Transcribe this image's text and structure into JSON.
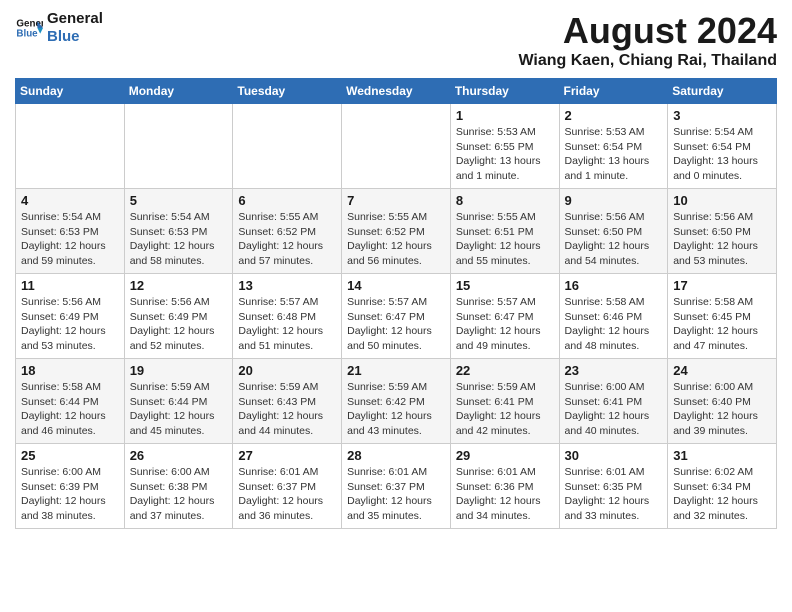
{
  "logo": {
    "text_general": "General",
    "text_blue": "Blue"
  },
  "title": {
    "month": "August 2024",
    "location": "Wiang Kaen, Chiang Rai, Thailand"
  },
  "weekdays": [
    "Sunday",
    "Monday",
    "Tuesday",
    "Wednesday",
    "Thursday",
    "Friday",
    "Saturday"
  ],
  "weeks": [
    [
      {
        "day": "",
        "info": ""
      },
      {
        "day": "",
        "info": ""
      },
      {
        "day": "",
        "info": ""
      },
      {
        "day": "",
        "info": ""
      },
      {
        "day": "1",
        "info": "Sunrise: 5:53 AM\nSunset: 6:55 PM\nDaylight: 13 hours\nand 1 minute."
      },
      {
        "day": "2",
        "info": "Sunrise: 5:53 AM\nSunset: 6:54 PM\nDaylight: 13 hours\nand 1 minute."
      },
      {
        "day": "3",
        "info": "Sunrise: 5:54 AM\nSunset: 6:54 PM\nDaylight: 13 hours\nand 0 minutes."
      }
    ],
    [
      {
        "day": "4",
        "info": "Sunrise: 5:54 AM\nSunset: 6:53 PM\nDaylight: 12 hours\nand 59 minutes."
      },
      {
        "day": "5",
        "info": "Sunrise: 5:54 AM\nSunset: 6:53 PM\nDaylight: 12 hours\nand 58 minutes."
      },
      {
        "day": "6",
        "info": "Sunrise: 5:55 AM\nSunset: 6:52 PM\nDaylight: 12 hours\nand 57 minutes."
      },
      {
        "day": "7",
        "info": "Sunrise: 5:55 AM\nSunset: 6:52 PM\nDaylight: 12 hours\nand 56 minutes."
      },
      {
        "day": "8",
        "info": "Sunrise: 5:55 AM\nSunset: 6:51 PM\nDaylight: 12 hours\nand 55 minutes."
      },
      {
        "day": "9",
        "info": "Sunrise: 5:56 AM\nSunset: 6:50 PM\nDaylight: 12 hours\nand 54 minutes."
      },
      {
        "day": "10",
        "info": "Sunrise: 5:56 AM\nSunset: 6:50 PM\nDaylight: 12 hours\nand 53 minutes."
      }
    ],
    [
      {
        "day": "11",
        "info": "Sunrise: 5:56 AM\nSunset: 6:49 PM\nDaylight: 12 hours\nand 53 minutes."
      },
      {
        "day": "12",
        "info": "Sunrise: 5:56 AM\nSunset: 6:49 PM\nDaylight: 12 hours\nand 52 minutes."
      },
      {
        "day": "13",
        "info": "Sunrise: 5:57 AM\nSunset: 6:48 PM\nDaylight: 12 hours\nand 51 minutes."
      },
      {
        "day": "14",
        "info": "Sunrise: 5:57 AM\nSunset: 6:47 PM\nDaylight: 12 hours\nand 50 minutes."
      },
      {
        "day": "15",
        "info": "Sunrise: 5:57 AM\nSunset: 6:47 PM\nDaylight: 12 hours\nand 49 minutes."
      },
      {
        "day": "16",
        "info": "Sunrise: 5:58 AM\nSunset: 6:46 PM\nDaylight: 12 hours\nand 48 minutes."
      },
      {
        "day": "17",
        "info": "Sunrise: 5:58 AM\nSunset: 6:45 PM\nDaylight: 12 hours\nand 47 minutes."
      }
    ],
    [
      {
        "day": "18",
        "info": "Sunrise: 5:58 AM\nSunset: 6:44 PM\nDaylight: 12 hours\nand 46 minutes."
      },
      {
        "day": "19",
        "info": "Sunrise: 5:59 AM\nSunset: 6:44 PM\nDaylight: 12 hours\nand 45 minutes."
      },
      {
        "day": "20",
        "info": "Sunrise: 5:59 AM\nSunset: 6:43 PM\nDaylight: 12 hours\nand 44 minutes."
      },
      {
        "day": "21",
        "info": "Sunrise: 5:59 AM\nSunset: 6:42 PM\nDaylight: 12 hours\nand 43 minutes."
      },
      {
        "day": "22",
        "info": "Sunrise: 5:59 AM\nSunset: 6:41 PM\nDaylight: 12 hours\nand 42 minutes."
      },
      {
        "day": "23",
        "info": "Sunrise: 6:00 AM\nSunset: 6:41 PM\nDaylight: 12 hours\nand 40 minutes."
      },
      {
        "day": "24",
        "info": "Sunrise: 6:00 AM\nSunset: 6:40 PM\nDaylight: 12 hours\nand 39 minutes."
      }
    ],
    [
      {
        "day": "25",
        "info": "Sunrise: 6:00 AM\nSunset: 6:39 PM\nDaylight: 12 hours\nand 38 minutes."
      },
      {
        "day": "26",
        "info": "Sunrise: 6:00 AM\nSunset: 6:38 PM\nDaylight: 12 hours\nand 37 minutes."
      },
      {
        "day": "27",
        "info": "Sunrise: 6:01 AM\nSunset: 6:37 PM\nDaylight: 12 hours\nand 36 minutes."
      },
      {
        "day": "28",
        "info": "Sunrise: 6:01 AM\nSunset: 6:37 PM\nDaylight: 12 hours\nand 35 minutes."
      },
      {
        "day": "29",
        "info": "Sunrise: 6:01 AM\nSunset: 6:36 PM\nDaylight: 12 hours\nand 34 minutes."
      },
      {
        "day": "30",
        "info": "Sunrise: 6:01 AM\nSunset: 6:35 PM\nDaylight: 12 hours\nand 33 minutes."
      },
      {
        "day": "31",
        "info": "Sunrise: 6:02 AM\nSunset: 6:34 PM\nDaylight: 12 hours\nand 32 minutes."
      }
    ]
  ]
}
